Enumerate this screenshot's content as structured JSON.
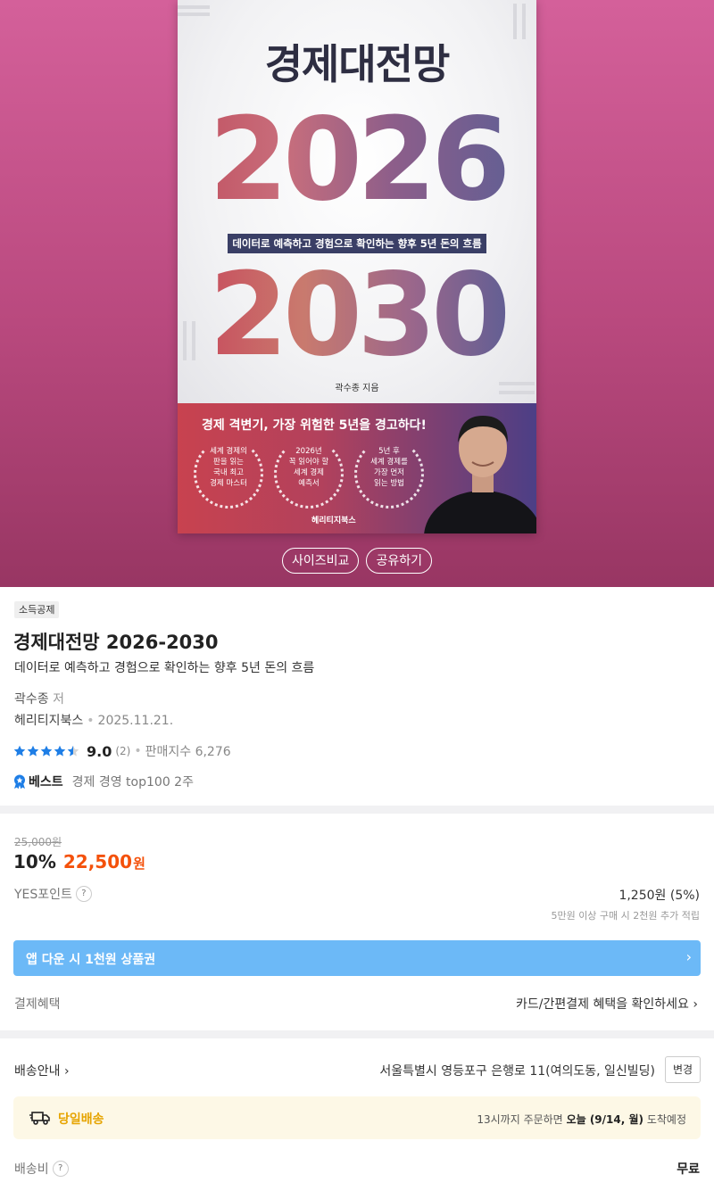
{
  "cover": {
    "title": "경제대전망",
    "year_top": "2026",
    "year_bottom": "2030",
    "subtitle": "데이터로 예측하고 경험으로 확인하는 향후 5년 돈의 흐름",
    "author": "곽수종 지음",
    "tagline": "경제 격변기, 가장 위험한 5년을 경고하다!",
    "laurels": [
      {
        "text": "세계 경제의\n판을 읽는\n국내 최고\n경제 마스터"
      },
      {
        "text": "2026년\n꼭 읽어야 할\n세계 경제\n예측서"
      },
      {
        "text": "5년 후\n세계 경제를\n가장 먼저\n읽는 방법"
      }
    ],
    "publisher_logo": "헤리티지북스"
  },
  "hero_buttons": {
    "size_compare": "사이즈비교",
    "share": "공유하기"
  },
  "product": {
    "badge": "소득공제",
    "title": "경제대전망 2026-2030",
    "subtitle": "데이터로 예측하고 경험으로 확인하는 향후 5년 돈의 흐름",
    "author": "곽수종",
    "author_role": "저",
    "publisher": "헤리티지북스",
    "date": "2025.11.21.",
    "rating": "9.0",
    "stars": 4.5,
    "review_count": "(2)",
    "sales_index": "판매지수 6,276",
    "best_label": "베스트",
    "best_rank": "경제 경영 top100 2주"
  },
  "price": {
    "original": "25,000원",
    "discount": "10%",
    "sale": "22,500",
    "currency": "원",
    "yes_point_label": "YES포인트",
    "yes_point_value": "1,250원 (5%)",
    "yes_point_note": "5만원 이상 구매 시 2천원 추가 적립",
    "promo_label": "앱 다운 시 1천원 상품권",
    "promo_arrow": "›",
    "payment_label": "결제혜택",
    "payment_value": "카드/간편결제 혜택을 확인하세요 ›"
  },
  "shipping": {
    "label": "배송안내 ›",
    "address": "서울특별시 영등포구 은행로 11(여의도동, 일신빌딩)",
    "change_button": "변경",
    "sameday_label": "당일배송",
    "sameday_prefix": "13시까지 주문하면",
    "sameday_date": "오늘 (9/14, 월)",
    "sameday_suffix": "도착예정",
    "fee_label": "배송비",
    "fee_value": "무료",
    "help": "?"
  },
  "colors": {
    "hero_top": "#d4609a",
    "hero_bottom": "#983663",
    "sale_price": "#f4510b",
    "promo_bg": "#6cb9f7",
    "sameday_accent": "#e6a400",
    "star": "#1e7ee6"
  }
}
